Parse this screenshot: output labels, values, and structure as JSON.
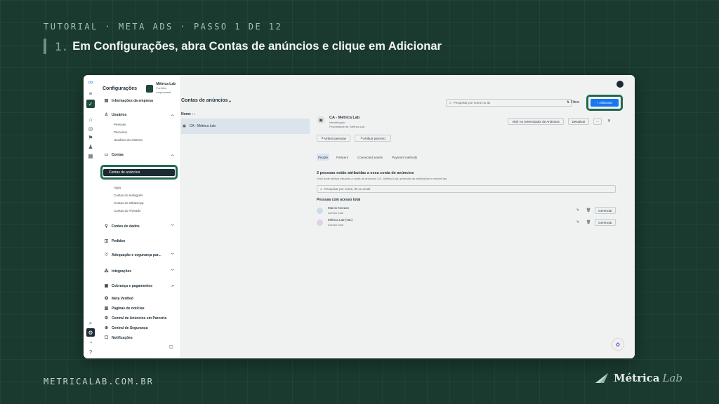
{
  "header": {
    "kicker": "TUTORIAL · META ADS · PASSO 1 DE 12",
    "step_number": "1.",
    "step_text": "Em Configurações, abra Contas de anúncios e clique em Adicionar"
  },
  "footer": {
    "url": "METRICALAB.COM.BR",
    "brand_bold": "Métrica",
    "brand_italic": "Lab"
  },
  "app": {
    "title": "Configurações",
    "business_name": "Métrica Lab",
    "business_sub": "Portfólio empresarial",
    "sidebar": {
      "company_info": "Informações da empresa",
      "users": "Usuários",
      "users_items": [
        "Pessoas",
        "Parceiros",
        "Usuários do sistema"
      ],
      "accounts": "Contas",
      "accounts_selected": "Contas de anúncios",
      "accounts_items": [
        "Apps",
        "Contas do Instagram",
        "Contas do WhatsApp",
        "Contas do Threads"
      ],
      "data_sources": "Fontes de dados",
      "orders": "Pedidos",
      "safety": "Adequação e segurança par...",
      "integrations": "Integrações",
      "billing": "Cobrança e pagamentos",
      "meta_verified": "Meta Verified",
      "news": "Páginas de notícias",
      "partner_ads": "Central de Anúncios em Parceria",
      "security": "Central de Segurança",
      "notifications": "Notificações"
    },
    "list": {
      "title": "Contas de anúncios",
      "column": "Nome ↑↓",
      "rows": [
        "CA - Métrica Lab"
      ]
    },
    "toolbar": {
      "search_placeholder": "Pesquisar por nome ou ID",
      "filter": "Filtrar",
      "add": "+ Adicionar"
    },
    "detail": {
      "account_name": "CA - Métrica Lab",
      "account_id": "Identificação",
      "owner": "Propriedade de: Métrica Lab",
      "open_manager": "Abrir no Gerenciador de Anúncios",
      "deactivate": "Desativar",
      "more": "···",
      "close": "✕",
      "assign_people": "Atribuir pessoas",
      "assign_partner": "Atribuir parceiro",
      "tabs": [
        "People",
        "Partners",
        "Connected assets",
        "Payment methods"
      ],
      "people_heading": "2 pessoas estão atribuídas a essa conta de anúncios",
      "people_desc": "Você pode atribuir pessoas à conta de anúncios CA - Métrica Lab, gerenciar as atribuições e removê-las.",
      "people_search_placeholder": "Pesquisar por nome, ID ou email",
      "full_access_heading": "Pessoas com acesso total",
      "people": [
        {
          "name": "Marcio Novaes",
          "role": "Acesso total",
          "action": "Gerenciar"
        },
        {
          "name": "Métrica Lab (Vac)",
          "role": "Acesso total",
          "action": "Gerenciar"
        }
      ]
    }
  }
}
